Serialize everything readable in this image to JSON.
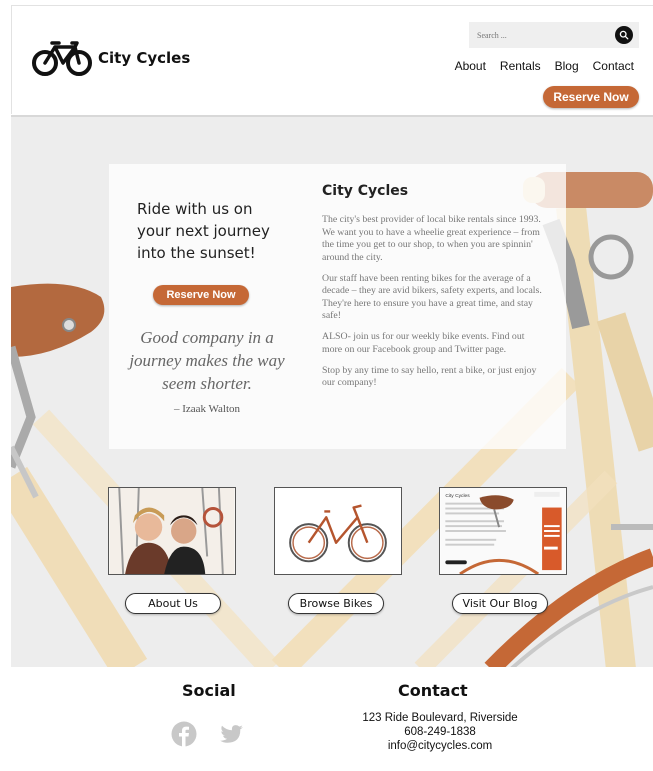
{
  "header": {
    "brand": "City Cycles",
    "search_placeholder": "Search ...",
    "nav": [
      "About",
      "Rentals",
      "Blog",
      "Contact"
    ],
    "reserve_label": "Reserve Now"
  },
  "hero": {
    "tagline": "Ride with us on your next journey into the sunset!",
    "reserve_label": "Reserve Now",
    "quote": "Good company in a journey makes the way seem shorter.",
    "quote_author": "– Izaak Walton",
    "title": "City Cycles",
    "paragraphs": [
      "The city's best provider of local bike rentals since 1993. We want you to have a wheelie great experience – from the time you get to our shop, to when you are spinnin' around the city.",
      "Our staff have been renting bikes for the average of a decade – they are avid bikers, safety experts, and locals. They're here to ensure you have a great time, and stay safe!",
      "ALSO- join us for our weekly bike events. Find out more on our Facebook group and Twitter page.",
      "Stop by any time to say hello, rent a bike, or just enjoy our company!"
    ],
    "links": [
      {
        "label": "About Us",
        "icon": "staff-photo"
      },
      {
        "label": "Browse Bikes",
        "icon": "bike-photo"
      },
      {
        "label": "Visit Our Blog",
        "icon": "blog-screenshot"
      }
    ],
    "blog_thumb_brand": "City Cycles"
  },
  "footer": {
    "social_title": "Social",
    "social_icons": [
      "facebook-icon",
      "twitter-icon"
    ],
    "contact_title": "Contact",
    "address": "123 Ride Boulevard, Riverside",
    "phone": "608-249-1838",
    "email": "info@citycycles.com"
  },
  "colors": {
    "accent": "#c56836",
    "hero_bg": "#ededed",
    "search_bg": "#efefef",
    "social_icon": "#c8c8c8"
  }
}
